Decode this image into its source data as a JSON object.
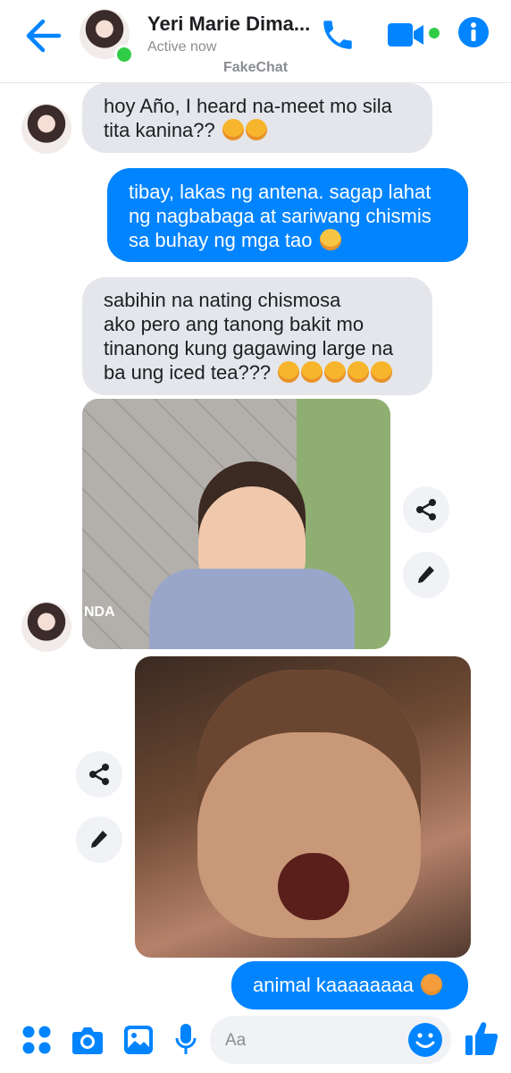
{
  "header": {
    "title": "Yeri Marie Dima...",
    "status": "Active now",
    "brand": "FakeChat"
  },
  "messages": [
    {
      "side": "in",
      "lines": [
        "hoy Año, I heard na-meet mo sila",
        "tita kanina??"
      ]
    },
    {
      "side": "out",
      "lines": [
        "tibay, lakas ng antena. sagap lahat",
        "ng nagbabaga at sariwang chismis",
        "sa buhay ng mga tao"
      ]
    },
    {
      "side": "in",
      "lines": [
        "sabihin na nating chismosa",
        "ako pero ang tanong bakit mo",
        "tinanong kung gagawing large na",
        "ba ung iced tea???"
      ]
    },
    {
      "side": "out",
      "lines": [
        "animal kaaaaaaaa"
      ]
    }
  ],
  "photo1": {
    "watermark": "NDA"
  },
  "composer": {
    "placeholder": "Aa"
  },
  "colors": {
    "accent": "#0084ff",
    "incoming": "#e4e6eb",
    "online": "#31cc46"
  },
  "icons": [
    "back-arrow-icon",
    "phone-icon",
    "video-icon",
    "info-icon",
    "share-icon",
    "pencil-icon",
    "apps-icon",
    "camera-icon",
    "gallery-icon",
    "mic-icon",
    "emoji-icon",
    "like-icon"
  ]
}
